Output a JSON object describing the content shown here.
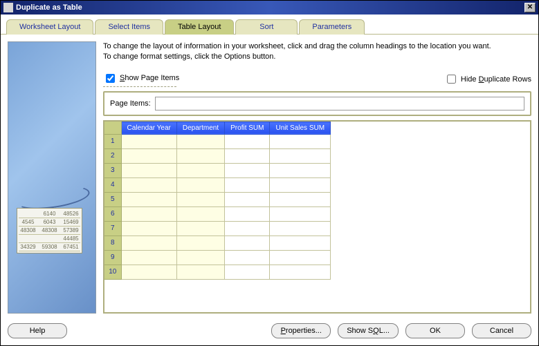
{
  "window": {
    "title": "Duplicate as Table"
  },
  "tabs": [
    {
      "label": "Worksheet Layout",
      "selected": false
    },
    {
      "label": "Select Items",
      "selected": false
    },
    {
      "label": "Table Layout",
      "selected": true
    },
    {
      "label": "Sort",
      "selected": false
    },
    {
      "label": "Parameters",
      "selected": false
    }
  ],
  "instructions": {
    "line1": "To change the layout of information in your worksheet, click and drag the column headings to the location you want.",
    "line2": "To change format settings, click the Options button."
  },
  "options": {
    "show_page_items_label": "Show Page Items",
    "show_page_items_checked": true,
    "hide_duplicate_rows_label": "Hide Duplicate Rows",
    "hide_duplicate_rows_checked": false
  },
  "page_items": {
    "label": "Page Items:",
    "value": ""
  },
  "table": {
    "columns": [
      "Calendar Year",
      "Department",
      "Profit SUM",
      "Unit Sales SUM"
    ],
    "yellow_cols": 2,
    "row_count": 10
  },
  "buttons": {
    "help": "Help",
    "properties": "Properties...",
    "show_sql": "Show SQL...",
    "ok": "OK",
    "cancel": "Cancel"
  },
  "decor_rows": [
    [
      "",
      "6140",
      "48526"
    ],
    [
      "4545",
      "6043",
      "15469"
    ],
    [
      "48308",
      "48308",
      "57389"
    ],
    [
      "",
      "",
      "44485"
    ],
    [
      "34329",
      "59308",
      "67451"
    ]
  ]
}
